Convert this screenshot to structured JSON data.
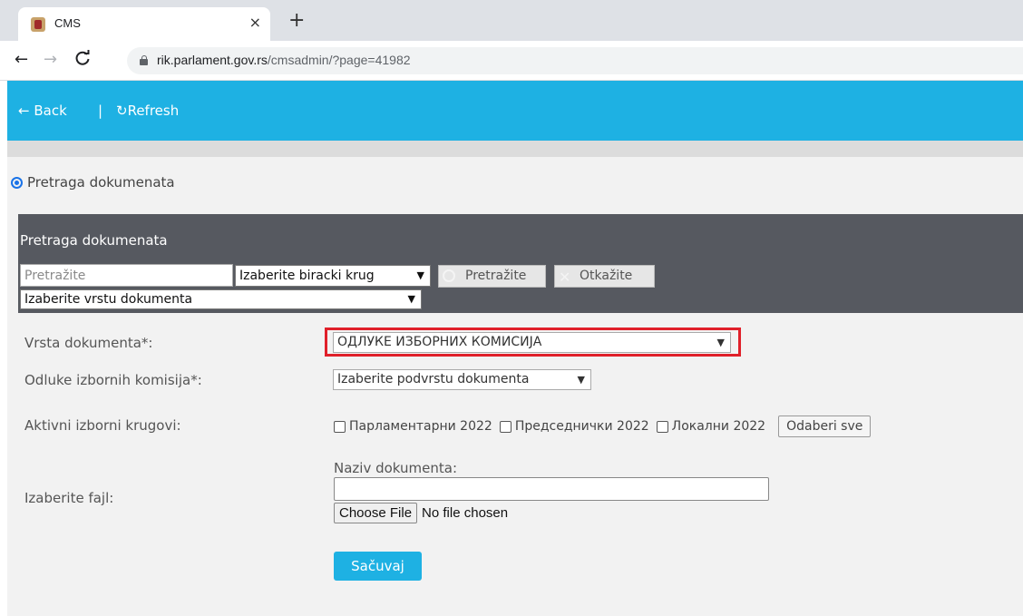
{
  "browser": {
    "tab_title": "CMS",
    "tab_close": "×",
    "new_tab": "+",
    "url_host": "rik.parlament.gov.rs",
    "url_path": "/cmsadmin/?page=41982",
    "icons": {
      "back": "←",
      "forward": "→",
      "reload": "C"
    }
  },
  "header": {
    "back_label": "← Back",
    "separator": "|",
    "refresh_label": "↻Refresh",
    "color": "#1eb1e3"
  },
  "radio": {
    "label": "Pretraga dokumenata"
  },
  "search_panel": {
    "title": "Pretraga dokumenata",
    "search_placeholder": "Pretražite",
    "krug_select": "Izaberite biracki krug",
    "search_button": "Pretražite",
    "cancel_button": "Otkažite",
    "vrsta_select": "Izaberite vrstu dokumenta"
  },
  "form": {
    "vrsta_label": "Vrsta dokumenta*:",
    "vrsta_value": "ОДЛУКЕ ИЗБОРНИХ КОМИСИЈА",
    "odluke_label": "Odluke izbornih komisija*:",
    "podvrsta_value": "Izaberite podvrstu dokumenta",
    "krugovi_label": "Aktivni izborni krugovi:",
    "krugovi": [
      "Парламентарни 2022",
      "Председнички 2022",
      "Локални 2022"
    ],
    "select_all": "Odaberi sve",
    "naziv_label": "Naziv dokumenta:",
    "fajl_label": "Izaberite fajl:",
    "choose_file": "Choose File",
    "no_file": "No file chosen",
    "save": "Sačuvaj",
    "highlight_color": "#e0202a"
  }
}
